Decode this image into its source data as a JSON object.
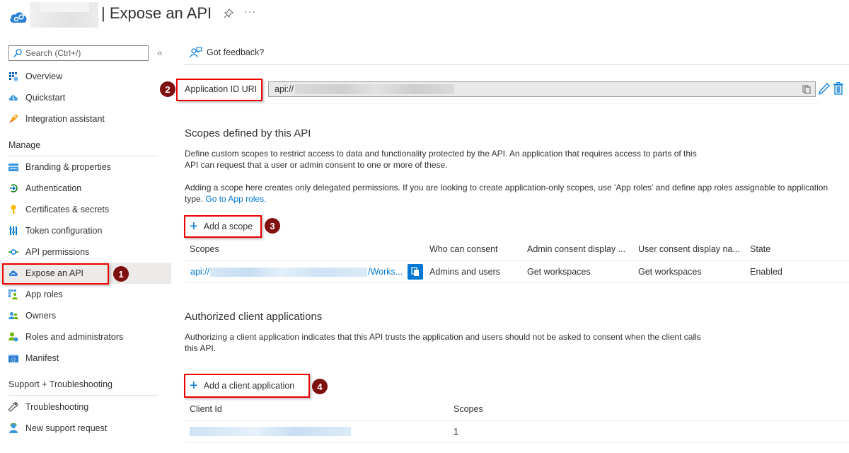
{
  "header": {
    "title": "| Expose an API",
    "pin_icon": "pin-icon",
    "more_icon": "ellipsis-icon",
    "more_label": "···"
  },
  "sidebar": {
    "search_placeholder": "Search (Ctrl+/)",
    "collapse_label": "«",
    "top_items": [
      {
        "label": "Overview",
        "icon": "overview-grid-icon"
      },
      {
        "label": "Quickstart",
        "icon": "quickstart-cloud-icon"
      },
      {
        "label": "Integration assistant",
        "icon": "rocket-icon"
      }
    ],
    "manage_title": "Manage",
    "manage_items": [
      {
        "label": "Branding & properties",
        "icon": "branding-card-icon"
      },
      {
        "label": "Authentication",
        "icon": "authentication-arrow-icon"
      },
      {
        "label": "Certificates & secrets",
        "icon": "key-icon"
      },
      {
        "label": "Token configuration",
        "icon": "token-bars-icon"
      },
      {
        "label": "API permissions",
        "icon": "api-permissions-icon"
      },
      {
        "label": "Expose an API",
        "icon": "cloud-icon",
        "active": true
      },
      {
        "label": "App roles",
        "icon": "app-roles-icon"
      },
      {
        "label": "Owners",
        "icon": "owners-icon"
      },
      {
        "label": "Roles and administrators",
        "icon": "roles-admin-icon"
      },
      {
        "label": "Manifest",
        "icon": "manifest-icon"
      }
    ],
    "support_title": "Support + Troubleshooting",
    "support_items": [
      {
        "label": "Troubleshooting",
        "icon": "wrench-icon"
      },
      {
        "label": "New support request",
        "icon": "support-person-icon"
      }
    ]
  },
  "main": {
    "feedback_label": "Got feedback?",
    "app_id_uri": {
      "label": "Application ID URI",
      "value_prefix": "api://"
    },
    "scopes_section": {
      "title": "Scopes defined by this API",
      "desc1": "Define custom scopes to restrict access to data and functionality protected by the API. An application that requires access to parts of this API can request that a user or admin consent to one or more of these.",
      "desc2": "Adding a scope here creates only delegated permissions. If you are looking to create application-only scopes, use 'App roles' and define app roles assignable to application type.",
      "desc2_link": "Go to App roles.",
      "add_button": "Add a scope",
      "columns": [
        "Scopes",
        "Who can consent",
        "Admin consent display ...",
        "User consent display na...",
        "State"
      ],
      "rows": [
        {
          "scope_prefix": "api://",
          "scope_suffix": "/Works...",
          "who": "Admins and users",
          "admin_display": "Get workspaces",
          "user_display": "Get workspaces",
          "state": "Enabled"
        }
      ]
    },
    "clients_section": {
      "title": "Authorized client applications",
      "desc": "Authorizing a client application indicates that this API trusts the application and users should not be asked to consent when the client calls this API.",
      "add_button": "Add a client application",
      "columns": [
        "Client Id",
        "Scopes"
      ],
      "rows": [
        {
          "scopes": "1"
        }
      ]
    }
  },
  "annotations": [
    "1",
    "2",
    "3",
    "4"
  ],
  "colors": {
    "accent": "#0078d4",
    "annotation_border": "#ee0000",
    "badge": "#7f1010",
    "active_nav": "#edebe9"
  }
}
